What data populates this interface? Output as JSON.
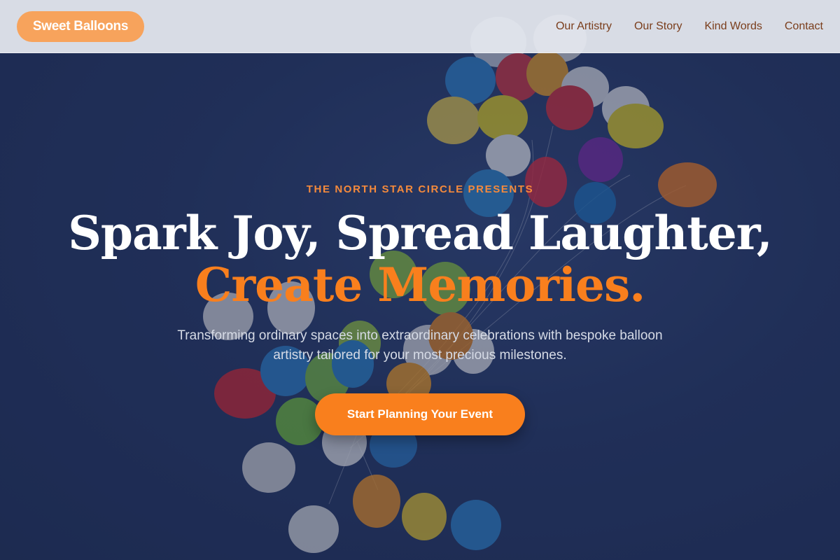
{
  "header": {
    "logo": "Sweet Balloons",
    "nav": [
      "Our Artistry",
      "Our Story",
      "Kind Words",
      "Contact"
    ]
  },
  "hero": {
    "eyebrow": "THE NORTH STAR CIRCLE PRESENTS",
    "headline_line1": "Spark Joy, Spread Laughter,",
    "headline_line2": "Create Memories.",
    "subtitle": "Transforming ordinary spaces into extraordinary celebrations with bespoke balloon artistry tailored for your most precious milestones.",
    "cta_label": "Start Planning Your Event",
    "background_image": "balloon-bunch-photo"
  },
  "colors": {
    "accent": "#f97f1d",
    "logo_bg": "#f7a35c",
    "nav_text": "#7a3d1b",
    "hero_bg": "#24345a"
  }
}
